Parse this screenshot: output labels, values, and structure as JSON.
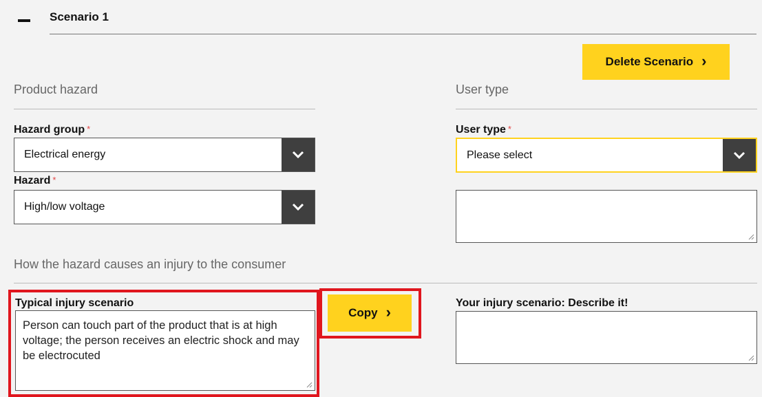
{
  "scenario": {
    "title": "Scenario 1",
    "delete_label": "Delete Scenario"
  },
  "product_hazard": {
    "section_title": "Product hazard",
    "hazard_group_label": "Hazard group",
    "hazard_group_value": "Electrical energy",
    "hazard_label": "Hazard",
    "hazard_value": "High/low voltage",
    "required_mark": "*"
  },
  "user_type": {
    "section_title": "User type",
    "user_type_label": "User type",
    "user_type_value": "Please select",
    "required_mark": "*",
    "extra_textarea_value": ""
  },
  "injury": {
    "section_title": "How the hazard causes an injury to the consumer",
    "typical_label": "Typical injury scenario",
    "typical_text": "Person can touch part of the product that is at high voltage; the person receives an electric shock and may be electrocuted",
    "copy_label": "Copy",
    "your_label": "Your injury scenario: Describe it!",
    "your_value": ""
  },
  "colors": {
    "accent_yellow": "#ffd21e",
    "highlight_red": "#e0161e",
    "required_red": "#e34545",
    "select_arrow_bg": "#3f3f3f"
  },
  "icons": {
    "collapse": "minus-icon",
    "button_arrow": "chevron-right-icon",
    "select_arrow": "chevron-down-icon",
    "resize": "resize-grip-icon"
  }
}
